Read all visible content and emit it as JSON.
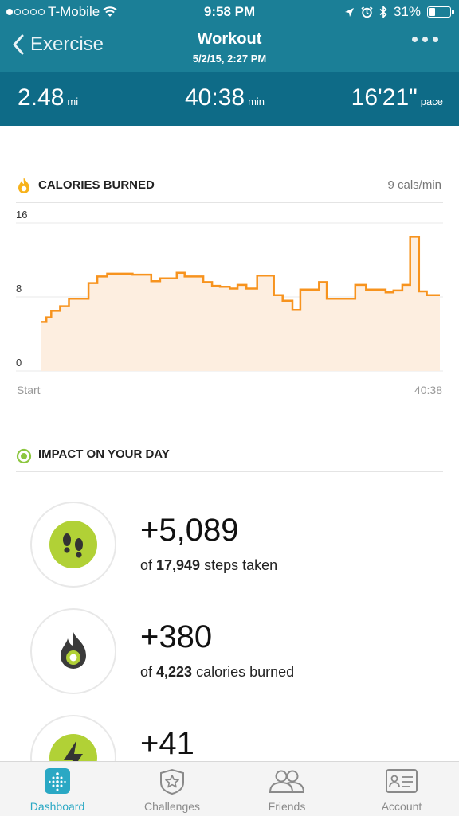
{
  "status_bar": {
    "carrier": "T-Mobile",
    "time": "9:58 PM",
    "battery": "31%",
    "battery_level": 0.31,
    "signal_bars": 1
  },
  "nav": {
    "back_label": "Exercise",
    "title": "Workout",
    "subtitle": "5/2/15, 2:27 PM"
  },
  "stats": {
    "distance": {
      "value": "2.48",
      "unit": "mi"
    },
    "duration": {
      "value": "40:38",
      "unit": "min"
    },
    "pace": {
      "value": "16'21\"",
      "unit": "pace"
    }
  },
  "calories_section": {
    "title": "CALORIES BURNED",
    "rate": "9 cals/min"
  },
  "chart_data": {
    "type": "area",
    "title": "CALORIES BURNED",
    "ylim": [
      0,
      16
    ],
    "yticks": [
      "16",
      "8",
      "0"
    ],
    "ytick_values": [
      16,
      8,
      0
    ],
    "x_start_label": "Start",
    "x_end_label": "40:38",
    "xlim": [
      0,
      40.63
    ],
    "step": true,
    "x": [
      0,
      0.5,
      1.0,
      1.9,
      2.8,
      4.8,
      5.7,
      6.7,
      9.3,
      11.2,
      12.1,
      13.8,
      14.6,
      16.5,
      17.4,
      18.2,
      19.2,
      20.0,
      20.9,
      22.0,
      23.7,
      24.6,
      25.6,
      26.4,
      28.3,
      29.1,
      31.0,
      32.0,
      33.1,
      35.1,
      35.9,
      36.8,
      37.6,
      38.5,
      39.3,
      40.0,
      40.63
    ],
    "values": [
      5.3,
      5.8,
      6.5,
      7.0,
      7.8,
      9.5,
      10.2,
      10.5,
      10.4,
      9.7,
      10.0,
      10.6,
      10.2,
      9.6,
      9.2,
      9.1,
      8.9,
      9.3,
      8.9,
      10.3,
      8.2,
      7.6,
      6.6,
      8.8,
      9.6,
      7.8,
      7.8,
      9.3,
      8.8,
      8.5,
      8.7,
      9.3,
      14.5,
      8.6,
      8.2,
      8.2
    ]
  },
  "impact_section": {
    "title": "IMPACT ON YOUR DAY",
    "items": [
      {
        "value": "+5,089",
        "prefix": "of ",
        "total": "17,949",
        "suffix": " steps taken",
        "icon": "footsteps-icon"
      },
      {
        "value": "+380",
        "prefix": "of ",
        "total": "4,223",
        "suffix": " calories burned",
        "icon": "flame-icon"
      },
      {
        "value": "+41",
        "icon": "lightning-icon"
      }
    ]
  },
  "tabs": [
    {
      "label": "Dashboard",
      "icon": "dashboard-icon",
      "active": true
    },
    {
      "label": "Challenges",
      "icon": "star-badge-icon",
      "active": false
    },
    {
      "label": "Friends",
      "icon": "friends-icon",
      "active": false
    },
    {
      "label": "Account",
      "icon": "id-card-icon",
      "active": false
    }
  ],
  "colors": {
    "header": "#1b7f97",
    "stats_band": "#0e6b87",
    "chart_line": "#f7931e",
    "chart_fill": "#fdeee0",
    "fitbit_green": "#b1d136",
    "tab_active": "#2aa8c4"
  }
}
